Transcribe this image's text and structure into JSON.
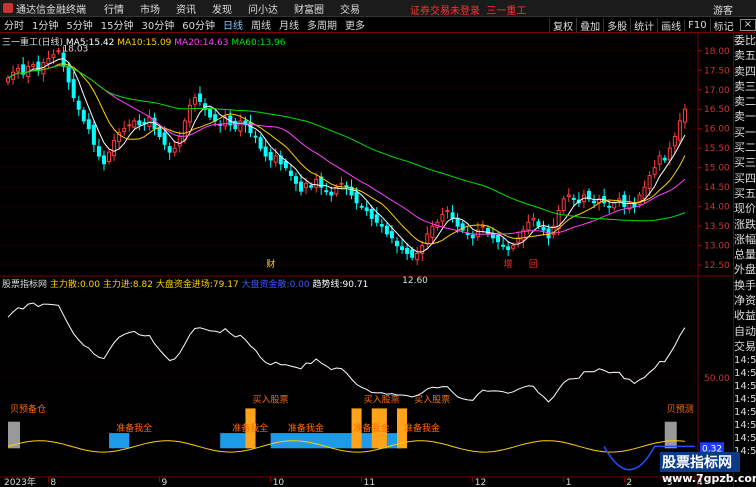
{
  "app": {
    "title": "通达信金融终端",
    "menu": [
      "行情",
      "市场",
      "资讯",
      "发现",
      "问小达",
      "财富圈",
      "交易"
    ],
    "alert": "证券交易未登录",
    "stock_name_top": "三一重工",
    "guest": "游客"
  },
  "toolbar": {
    "periods": [
      "分时",
      "1分钟",
      "5分钟",
      "15分钟",
      "30分钟",
      "60分钟",
      "日线",
      "周线",
      "月线",
      "多周期",
      "更多"
    ],
    "active_period": "日线",
    "right_buttons": [
      "复权",
      "叠加",
      "多股",
      "统计",
      "画线",
      "F10",
      "标记"
    ],
    "close_label": "×"
  },
  "main_chart": {
    "header": "三一重工(日线)",
    "ma": [
      {
        "label": "MA5:",
        "value": "15.42",
        "color": "#ffffff"
      },
      {
        "label": "MA10:",
        "value": "15.09",
        "color": "#ffd000"
      },
      {
        "label": "MA20:",
        "value": "14.63",
        "color": "#ff40ff"
      },
      {
        "label": "MA60:",
        "value": "13.96",
        "color": "#00e000"
      }
    ],
    "y_ticks": [
      "18.00",
      "17.50",
      "17.00",
      "16.50",
      "16.00",
      "15.50",
      "15.00",
      "14.50",
      "14.00",
      "13.50",
      "13.00",
      "12.50"
    ],
    "high_label": "18.03",
    "low_label": "12.60",
    "event_markers": [
      "财",
      "增",
      "回"
    ]
  },
  "indicator": {
    "name": "股票指标网",
    "fields": [
      {
        "label": "主力散:",
        "value": "0.00",
        "color": "#ffd000"
      },
      {
        "label": "主力进:",
        "value": "8.82",
        "color": "#ffd000"
      },
      {
        "label": "大盘资金进场:",
        "value": "79.17",
        "color": "#ffd000"
      },
      {
        "label": "大盘资金散:",
        "value": "0.00",
        "color": "#3b5bff"
      },
      {
        "label": "趋势线:",
        "value": "90.71",
        "color": "#ffffff"
      }
    ],
    "annotations": [
      "贝预备仓",
      "准备我全",
      "买入股票",
      "准备我全",
      "准备我金",
      "准备我金",
      "买入股票",
      "准备我金",
      "买入股票",
      "贝预测"
    ],
    "y_ticks": [
      "50.00",
      "0.32"
    ]
  },
  "x_labels": [
    "2023年",
    "8",
    "9",
    "10",
    "11",
    "12",
    "1",
    "2",
    "3",
    "4"
  ],
  "side_panel": {
    "labels": [
      "委比",
      "卖五",
      "卖四",
      "卖三",
      "卖二",
      "卖一",
      "买一",
      "买二",
      "买三",
      "买四",
      "买五",
      "现价",
      "涨跌",
      "涨幅",
      "总量",
      "外盘",
      "换手",
      "净资",
      "收益",
      "自动",
      "交易"
    ],
    "times": [
      "14:5",
      "14:5",
      "14:5",
      "14:5",
      "14:5",
      "14:5",
      "14:5",
      "14:5"
    ]
  },
  "watermark": {
    "line1": "股票指标网",
    "line2": "www.7gpzb.com"
  },
  "series": {
    "closes": [
      17.3,
      17.45,
      17.55,
      17.4,
      17.6,
      17.65,
      17.5,
      17.7,
      17.8,
      17.9,
      18.0,
      17.6,
      17.2,
      16.8,
      16.5,
      16.2,
      16.0,
      15.6,
      15.3,
      15.1,
      15.4,
      15.7,
      15.9,
      16.0,
      16.1,
      16.2,
      16.1,
      16.15,
      16.3,
      16.0,
      15.8,
      15.6,
      15.4,
      15.5,
      15.8,
      16.2,
      16.6,
      16.8,
      16.7,
      16.5,
      16.3,
      16.2,
      16.1,
      16.3,
      16.1,
      16.0,
      16.2,
      16.1,
      15.9,
      15.8,
      15.5,
      15.3,
      15.2,
      15.3,
      15.1,
      15.0,
      14.8,
      14.6,
      14.4,
      14.6,
      14.5,
      14.7,
      14.5,
      14.4,
      14.3,
      14.5,
      14.6,
      14.5,
      14.3,
      14.1,
      14.0,
      13.9,
      13.7,
      13.6,
      13.5,
      13.3,
      13.2,
      13.0,
      12.9,
      12.8,
      12.7,
      12.8,
      13.0,
      13.3,
      13.5,
      13.6,
      13.8,
      13.9,
      13.7,
      13.5,
      13.4,
      13.3,
      13.2,
      13.4,
      13.5,
      13.3,
      13.2,
      13.1,
      13.0,
      12.9,
      13.0,
      13.2,
      13.4,
      13.6,
      13.7,
      13.5,
      13.4,
      13.2,
      13.5,
      13.9,
      14.2,
      14.3,
      14.2,
      14.1,
      14.3,
      14.2,
      14.1,
      14.2,
      14.1,
      14.0,
      14.1,
      14.2,
      14.0,
      14.1,
      14.0,
      14.3,
      14.5,
      14.8,
      15.0,
      15.3,
      15.2,
      15.5,
      15.8,
      16.2,
      16.5
    ]
  }
}
